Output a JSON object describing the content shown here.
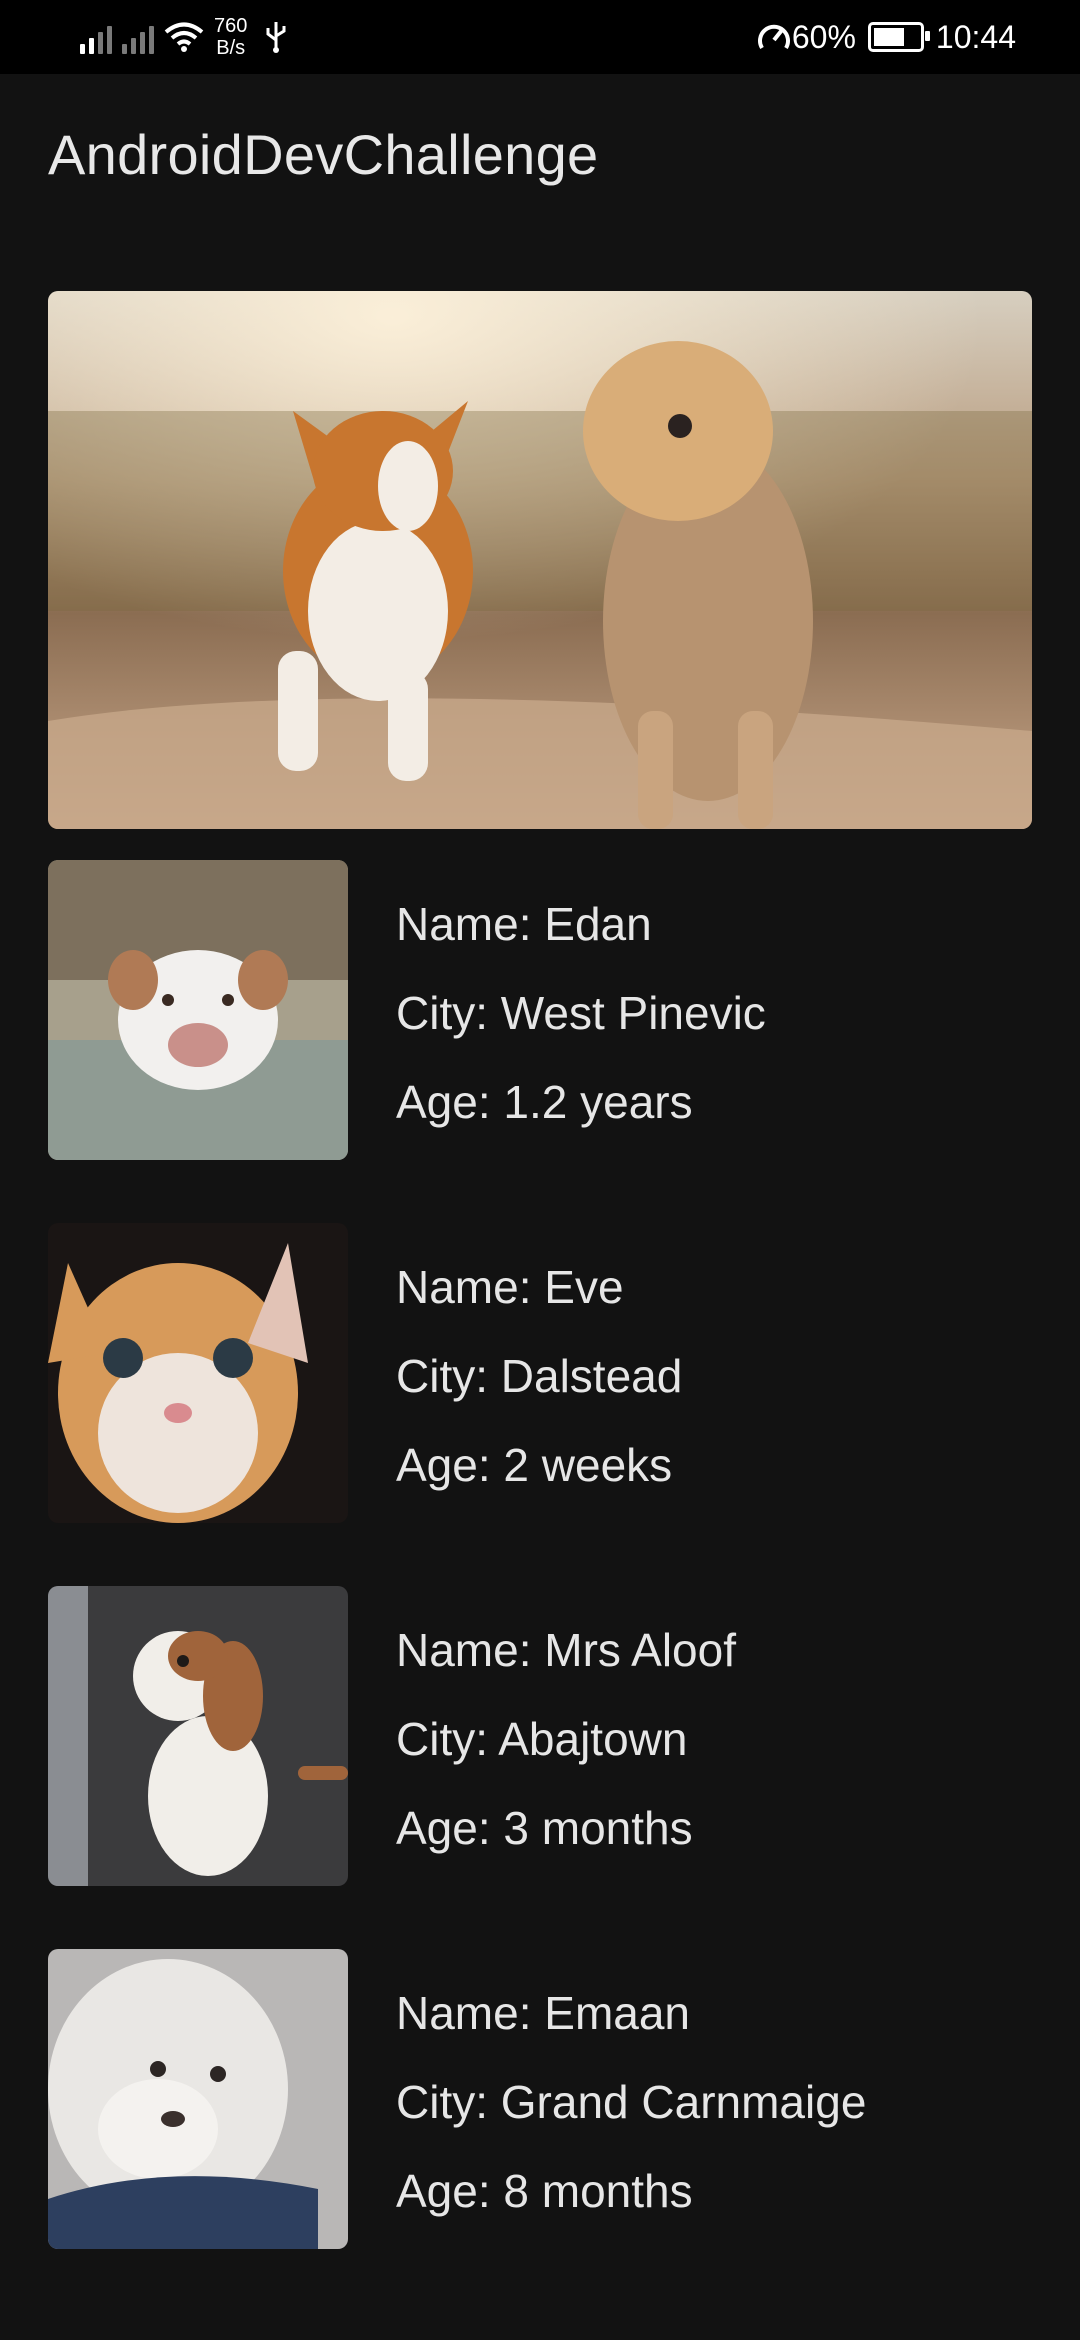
{
  "status_bar": {
    "net_speed_value": "760",
    "net_speed_unit": "B/s",
    "battery": "60%",
    "time": "10:44"
  },
  "app": {
    "title": "AndroidDevChallenge"
  },
  "hero": {
    "image": "two-dogs-running-photo"
  },
  "pets": [
    {
      "name": "Name: Edan",
      "city": "City: West Pinevic",
      "age": "Age: 1.2 years",
      "image": "white-pitbull-puppy-photo"
    },
    {
      "name": "Name: Eve",
      "city": "City: Dalstead",
      "age": "Age: 2 weeks",
      "image": "orange-kitten-photo"
    },
    {
      "name": "Name: Mrs Aloof",
      "city": "City: Abajtown",
      "age": "Age: 3 months",
      "image": "beagle-puppy-photo"
    },
    {
      "name": "Name: Emaan",
      "city": "City: Grand Carnmaige",
      "age": "Age: 8 months",
      "image": "white-poodle-photo"
    }
  ]
}
